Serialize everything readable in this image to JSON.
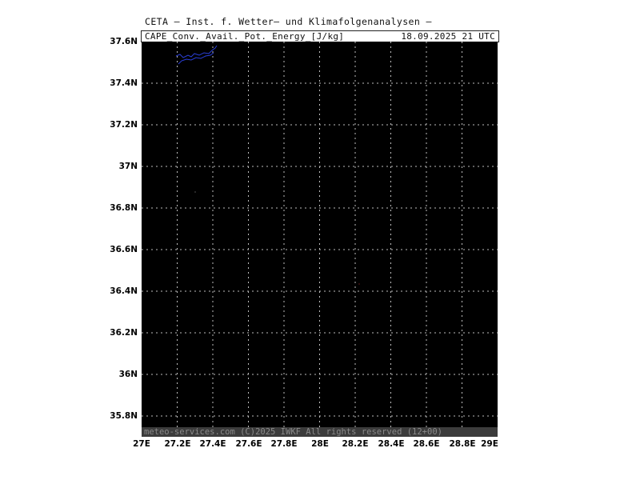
{
  "header": {
    "institute": "CETA – Inst. f. Wetter– und Klimafolgenanalysen –"
  },
  "title_box": {
    "parameter": "CAPE_Conv._Avail._Pot._Energy_[J/kg]",
    "datetime": "18.09.2025  21 UTC"
  },
  "footer": {
    "text": "meteo-services.com  (C)2025 IWKF  All rights reserved (12+00)"
  },
  "map": {
    "lat_labels": [
      "37.6N",
      "37.4N",
      "37.2N",
      "37N",
      "36.8N",
      "36.6N",
      "36.4N",
      "36.2N",
      "36N",
      "35.8N"
    ],
    "lon_labels": [
      "27E",
      "27.2E",
      "27.4E",
      "27.6E",
      "27.8E",
      "28E",
      "28.2E",
      "28.4E",
      "28.6E",
      "28.8E",
      "29E"
    ],
    "background_color": "#000000",
    "gridline_color": "#bdbdbd",
    "coastline_color": "#2a3fd8"
  }
}
